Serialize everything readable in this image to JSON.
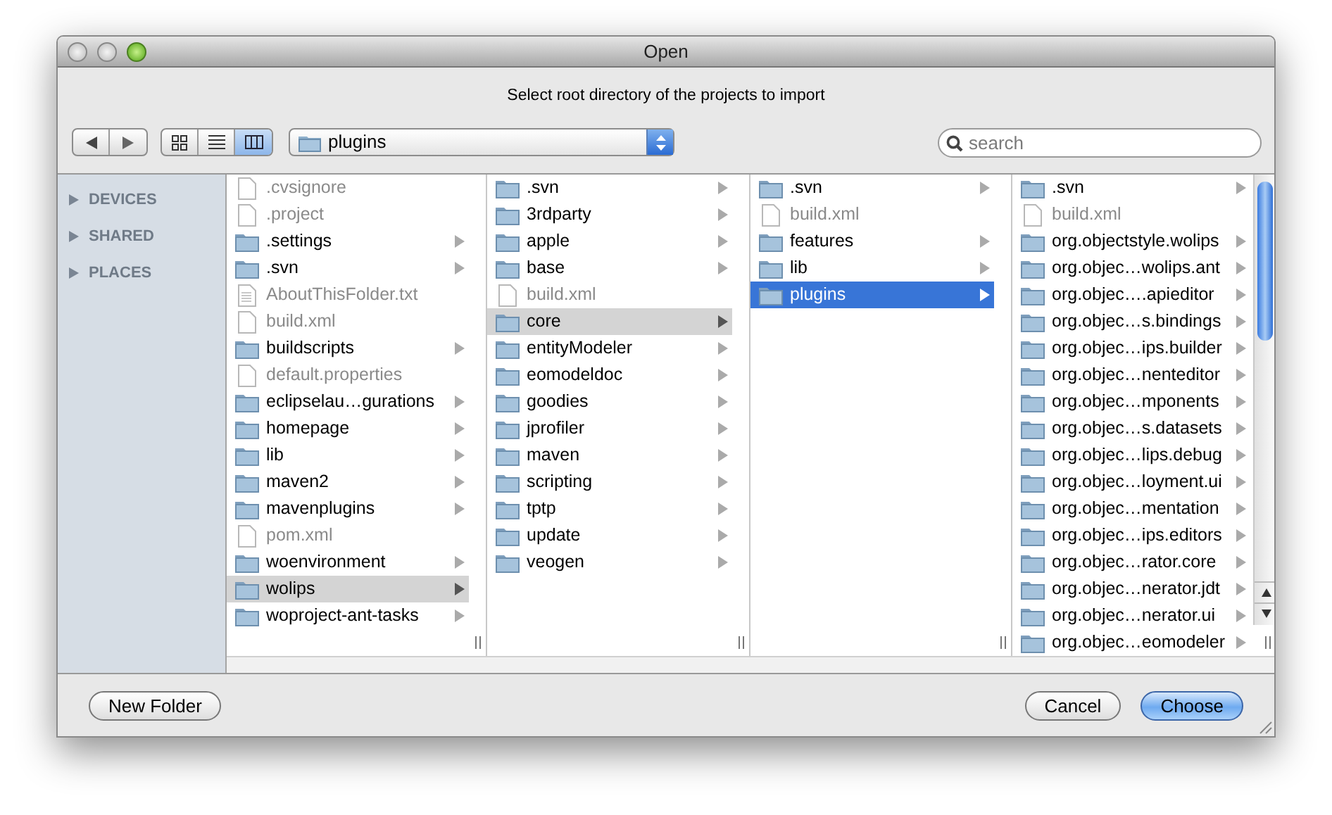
{
  "window": {
    "title": "Open"
  },
  "message": "Select root directory of the projects to import",
  "view_modes": [
    {
      "kind": "icon",
      "selected": false
    },
    {
      "kind": "list",
      "selected": false
    },
    {
      "kind": "column",
      "selected": true
    }
  ],
  "path_popup": {
    "value": "plugins"
  },
  "search": {
    "placeholder": "search"
  },
  "sidebar": {
    "sections": [
      {
        "label": "DEVICES",
        "expanded": false
      },
      {
        "label": "SHARED",
        "expanded": false
      },
      {
        "label": "PLACES",
        "expanded": false
      }
    ]
  },
  "columns": [
    {
      "items": [
        {
          "name": ".cvsignore",
          "kind": "file",
          "selected": false
        },
        {
          "name": ".project",
          "kind": "file",
          "selected": false
        },
        {
          "name": ".settings",
          "kind": "folder",
          "selected": false
        },
        {
          "name": ".svn",
          "kind": "folder",
          "selected": false
        },
        {
          "name": "AboutThisFolder.txt",
          "kind": "text_file",
          "selected": false
        },
        {
          "name": "build.xml",
          "kind": "file",
          "selected": false
        },
        {
          "name": "buildscripts",
          "kind": "folder",
          "selected": false
        },
        {
          "name": "default.properties",
          "kind": "file",
          "selected": false
        },
        {
          "name": "eclipselau…gurations",
          "kind": "folder",
          "selected": false
        },
        {
          "name": "homepage",
          "kind": "folder",
          "selected": false
        },
        {
          "name": "lib",
          "kind": "folder",
          "selected": false
        },
        {
          "name": "maven2",
          "kind": "folder",
          "selected": false
        },
        {
          "name": "mavenplugins",
          "kind": "folder",
          "selected": false
        },
        {
          "name": "pom.xml",
          "kind": "file",
          "selected": false
        },
        {
          "name": "woenvironment",
          "kind": "folder",
          "selected": false
        },
        {
          "name": "wolips",
          "kind": "folder",
          "selected": true
        },
        {
          "name": "woproject-ant-tasks",
          "kind": "folder",
          "selected": false
        }
      ]
    },
    {
      "items": [
        {
          "name": ".svn",
          "kind": "folder",
          "selected": false
        },
        {
          "name": "3rdparty",
          "kind": "folder",
          "selected": false
        },
        {
          "name": "apple",
          "kind": "folder",
          "selected": false
        },
        {
          "name": "base",
          "kind": "folder",
          "selected": false
        },
        {
          "name": "build.xml",
          "kind": "file",
          "selected": false
        },
        {
          "name": "core",
          "kind": "folder",
          "selected": true
        },
        {
          "name": "entityModeler",
          "kind": "folder",
          "selected": false
        },
        {
          "name": "eomodeldoc",
          "kind": "folder",
          "selected": false
        },
        {
          "name": "goodies",
          "kind": "folder",
          "selected": false
        },
        {
          "name": "jprofiler",
          "kind": "folder",
          "selected": false
        },
        {
          "name": "maven",
          "kind": "folder",
          "selected": false
        },
        {
          "name": "scripting",
          "kind": "folder",
          "selected": false
        },
        {
          "name": "tptp",
          "kind": "folder",
          "selected": false
        },
        {
          "name": "update",
          "kind": "folder",
          "selected": false
        },
        {
          "name": "veogen",
          "kind": "folder",
          "selected": false
        }
      ]
    },
    {
      "items": [
        {
          "name": ".svn",
          "kind": "folder",
          "selected": false
        },
        {
          "name": "build.xml",
          "kind": "file",
          "selected": false
        },
        {
          "name": "features",
          "kind": "folder",
          "selected": false
        },
        {
          "name": "lib",
          "kind": "folder",
          "selected": false
        },
        {
          "name": "plugins",
          "kind": "folder",
          "selected": true
        }
      ]
    },
    {
      "items": [
        {
          "name": ".svn",
          "kind": "folder",
          "selected": false
        },
        {
          "name": "build.xml",
          "kind": "file",
          "selected": false
        },
        {
          "name": "org.objectstyle.wolips",
          "kind": "folder",
          "selected": false
        },
        {
          "name": "org.objec…wolips.ant",
          "kind": "folder",
          "selected": false
        },
        {
          "name": "org.objec….apieditor",
          "kind": "folder",
          "selected": false
        },
        {
          "name": "org.objec…s.bindings",
          "kind": "folder",
          "selected": false
        },
        {
          "name": "org.objec…ips.builder",
          "kind": "folder",
          "selected": false
        },
        {
          "name": "org.objec…nenteditor",
          "kind": "folder",
          "selected": false
        },
        {
          "name": "org.objec…mponents",
          "kind": "folder",
          "selected": false
        },
        {
          "name": "org.objec…s.datasets",
          "kind": "folder",
          "selected": false
        },
        {
          "name": "org.objec…lips.debug",
          "kind": "folder",
          "selected": false
        },
        {
          "name": "org.objec…loyment.ui",
          "kind": "folder",
          "selected": false
        },
        {
          "name": "org.objec…mentation",
          "kind": "folder",
          "selected": false
        },
        {
          "name": "org.objec…ips.editors",
          "kind": "folder",
          "selected": false
        },
        {
          "name": "org.objec…rator.core",
          "kind": "folder",
          "selected": false
        },
        {
          "name": "org.objec…nerator.jdt",
          "kind": "folder",
          "selected": false
        },
        {
          "name": "org.objec…nerator.ui",
          "kind": "folder",
          "selected": false
        },
        {
          "name": "org.objec…eomodeler",
          "kind": "folder",
          "selected": false
        }
      ]
    }
  ],
  "buttons": [
    {
      "label": "New Folder",
      "default": false
    },
    {
      "label": "Cancel",
      "default": false
    },
    {
      "label": "Choose",
      "default": true
    }
  ]
}
